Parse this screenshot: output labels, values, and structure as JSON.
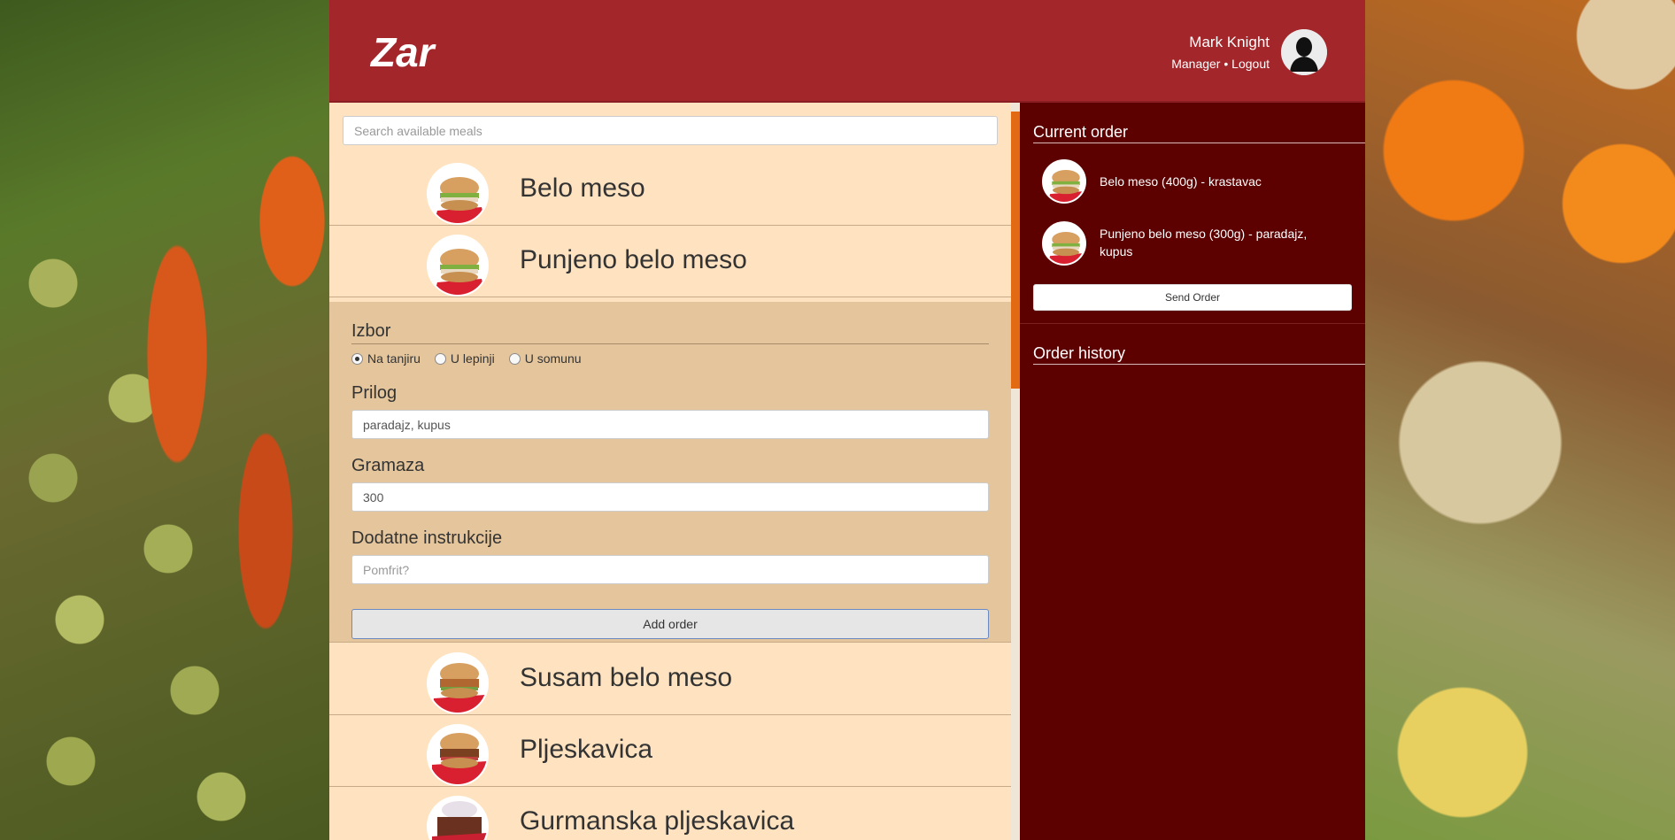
{
  "header": {
    "logo": "Zar",
    "user_name": "Mark Knight",
    "user_role": "Manager",
    "separator": "•",
    "logout_label": "Logout",
    "avatar_icon": "user-silhouette-icon"
  },
  "search": {
    "placeholder": "Search available meals",
    "value": ""
  },
  "meals": [
    {
      "name": "Belo meso"
    },
    {
      "name": "Punjeno belo meso"
    },
    {
      "name": "Susam belo meso"
    },
    {
      "name": "Pljeskavica"
    },
    {
      "name": "Gurmanska pljeskavica"
    }
  ],
  "order_form": {
    "choice_label": "Izbor",
    "options": [
      {
        "label": "Na tanjiru",
        "checked": true
      },
      {
        "label": "U lepinji",
        "checked": false
      },
      {
        "label": "U somunu",
        "checked": false
      }
    ],
    "side_label": "Prilog",
    "side_value": "paradajz, kupus",
    "weight_label": "Gramaza",
    "weight_value": "300",
    "instructions_label": "Dodatne instrukcije",
    "instructions_placeholder": "Pomfrit?",
    "add_button": "Add order"
  },
  "current_order": {
    "title": "Current order",
    "items": [
      {
        "text": "Belo meso (400g) - krastavac"
      },
      {
        "text": "Punjeno belo meso (300g) - paradajz, kupus"
      }
    ],
    "send_button": "Send Order"
  },
  "order_history": {
    "title": "Order history"
  },
  "colors": {
    "header": "#a3262a",
    "menu_bg": "#ffe3c0",
    "form_bg": "#e5c59b",
    "panel_bg": "#5c0000",
    "scroll_accent": "#e26a12"
  }
}
